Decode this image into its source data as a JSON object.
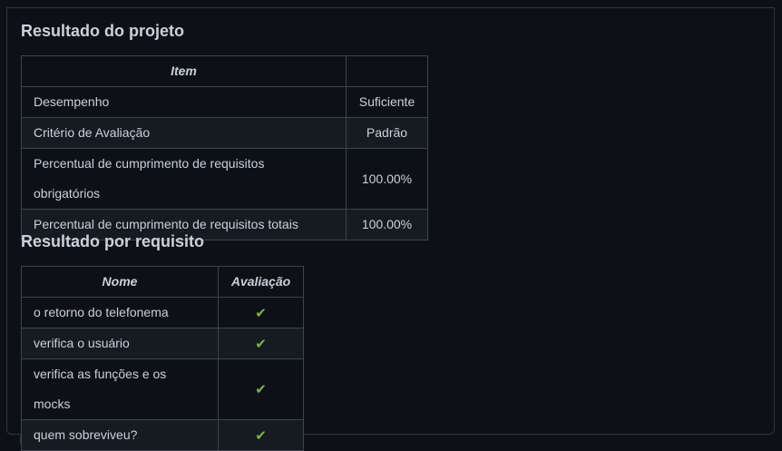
{
  "project_result": {
    "title": "Resultado do projeto",
    "headers": [
      "Item",
      ""
    ],
    "rows": [
      {
        "item": "Desempenho",
        "value": "Suficiente"
      },
      {
        "item": "Critério de Avaliação",
        "value": "Padrão"
      },
      {
        "item": "Percentual de cumprimento de requisitos obrigatórios",
        "value": "100.00%"
      },
      {
        "item": "Percentual de cumprimento de requisitos totais",
        "value": "100.00%"
      }
    ]
  },
  "requirement_result": {
    "title": "Resultado por requisito",
    "headers": [
      "Nome",
      "Avaliação"
    ],
    "rows": [
      {
        "name": "o retorno do telefonema",
        "status_icon": "check-icon"
      },
      {
        "name": "verifica o usuário",
        "status_icon": "check-icon"
      },
      {
        "name": "verifica as funções e os mocks",
        "status_icon": "check-icon"
      },
      {
        "name": "quem sobreviveu?",
        "status_icon": "check-icon"
      }
    ]
  },
  "colors": {
    "background": "#0d1117",
    "text": "#c9d1d9",
    "border": "#3d444d",
    "striped_row": "#161b22",
    "check": "#7ab648"
  }
}
